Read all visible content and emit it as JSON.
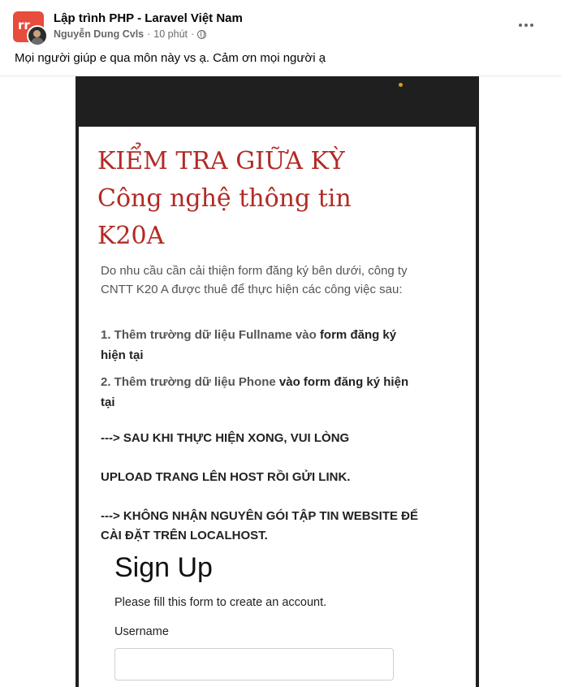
{
  "post": {
    "group_name": "Lập trình PHP - Laravel Việt Nam",
    "author": "Nguyễn Dung Cvls",
    "separator": "·",
    "time": "10 phút",
    "time_separator": "·",
    "text": "Mọi người giúp e qua môn này vs ạ. Cảm ơn mọi người ạ",
    "group_avatar_text": "rr"
  },
  "photo": {
    "title_lines": [
      "KIỂM TRA GIỮA KỲ",
      "Công nghệ thông tin",
      "K20A"
    ],
    "intro": "Do nhu cầu cần cải thiện form đăng ký bên dưới, công ty CNTT K20 A được thuê để thực hiện các công việc sau:",
    "item1": {
      "muted": "1. Thêm trường dữ liệu Fullname vào ",
      "bold": "form đăng ký hiện tại"
    },
    "item2": {
      "muted": "2. Thêm trường dữ liệu Phone ",
      "bold": "vào form đăng ký hiện tại"
    },
    "note1": "---> SAU KHI THỰC HIỆN XONG, VUI LÒNG",
    "note2": "UPLOAD TRANG LÊN HOST RỒI GỬI LINK.",
    "note3": "---> KHÔNG NHẬN NGUYÊN GÓI TẬP TIN WEBSITE ĐỂ CÀI ĐẶT TRÊN LOCALHOST.",
    "signup_title": "Sign Up",
    "signup_subtitle": "Please fill this form to create an account.",
    "username_label": "Username",
    "username_value": ""
  },
  "colors": {
    "title_red": "#b22a25",
    "photo_bg": "#1f1f1f",
    "avatar_red": "#e74c3c"
  },
  "icons": {
    "more": "more-horizontal-icon",
    "privacy": "globe-icon"
  }
}
